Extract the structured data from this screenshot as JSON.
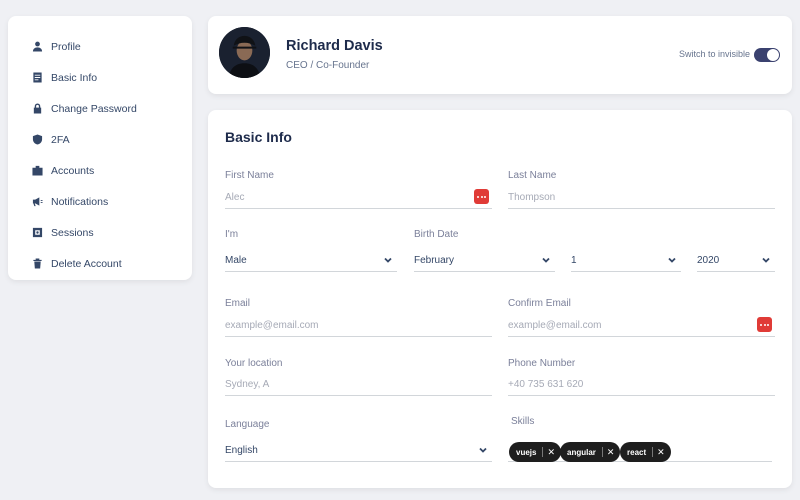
{
  "sidebar": {
    "items": [
      {
        "label": "Profile",
        "icon": "user-icon"
      },
      {
        "label": "Basic Info",
        "icon": "document-icon"
      },
      {
        "label": "Change Password",
        "icon": "lock-icon"
      },
      {
        "label": "2FA",
        "icon": "shield-icon"
      },
      {
        "label": "Accounts",
        "icon": "badge-icon"
      },
      {
        "label": "Notifications",
        "icon": "megaphone-icon"
      },
      {
        "label": "Sessions",
        "icon": "session-icon"
      },
      {
        "label": "Delete Account",
        "icon": "trash-icon"
      }
    ]
  },
  "profile": {
    "name": "Richard Davis",
    "role": "CEO / Co-Founder",
    "invisible_label": "Switch to invisible",
    "invisible_on": true
  },
  "basic_info": {
    "title": "Basic Info",
    "first_name": {
      "label": "First Name",
      "placeholder": "Alec"
    },
    "last_name": {
      "label": "Last Name",
      "placeholder": "Thompson"
    },
    "gender": {
      "label": "I'm",
      "value": "Male"
    },
    "birth_date": {
      "label": "Birth Date",
      "month": "February",
      "day": "1",
      "year": "2020"
    },
    "email": {
      "label": "Email",
      "placeholder": "example@email.com"
    },
    "confirm_email": {
      "label": "Confirm Email",
      "placeholder": "example@email.com"
    },
    "location": {
      "label": "Your location",
      "placeholder": "Sydney, A"
    },
    "phone": {
      "label": "Phone Number",
      "placeholder": "+40 735 631 620"
    },
    "language": {
      "label": "Language",
      "value": "English"
    },
    "skills": {
      "label": "Skills",
      "tags": [
        "vuejs",
        "angular",
        "react"
      ]
    }
  },
  "colors": {
    "accent": "#3a416f",
    "badge": "#e03b37",
    "chip": "#1e1e1e"
  }
}
